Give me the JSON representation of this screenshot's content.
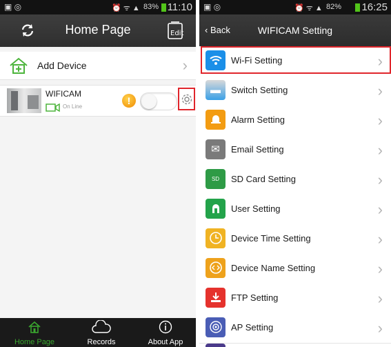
{
  "left": {
    "status": {
      "battery": "83%",
      "time": "11:10"
    },
    "title": "Home Page",
    "add_device_label": "Add Device",
    "device": {
      "name": "WIFICAM",
      "status": "On Line"
    },
    "nav": [
      {
        "label": "Home Page",
        "icon": "home-icon"
      },
      {
        "label": "Records",
        "icon": "cloud-icon"
      },
      {
        "label": "About App",
        "icon": "info-icon"
      }
    ]
  },
  "right": {
    "status": {
      "battery": "82%",
      "time": "16:25"
    },
    "back_label": "Back",
    "title": "WIFICAM Setting",
    "settings": [
      {
        "label": "Wi-Fi Setting",
        "icon": "wifi-icon",
        "color": "#1b8fe8"
      },
      {
        "label": "Switch Setting",
        "icon": "switch-icon",
        "color": "#3aa0e6"
      },
      {
        "label": "Alarm Setting",
        "icon": "bell-icon",
        "color": "#f39c12"
      },
      {
        "label": "Email Setting",
        "icon": "envelope-icon",
        "color": "#7a7a7a"
      },
      {
        "label": "SD Card Setting",
        "icon": "sd-card-icon",
        "color": "#2e9b46"
      },
      {
        "label": "User Setting",
        "icon": "user-icon",
        "color": "#23a34a"
      },
      {
        "label": "Device Time Setting",
        "icon": "clock-icon",
        "color": "#f0b323"
      },
      {
        "label": "Device Name Setting",
        "icon": "code-icon",
        "color": "#eea21c"
      },
      {
        "label": "FTP Setting",
        "icon": "download-icon",
        "color": "#e5322d"
      },
      {
        "label": "AP Setting",
        "icon": "ap-icon",
        "color": "#4a5db5"
      }
    ]
  }
}
